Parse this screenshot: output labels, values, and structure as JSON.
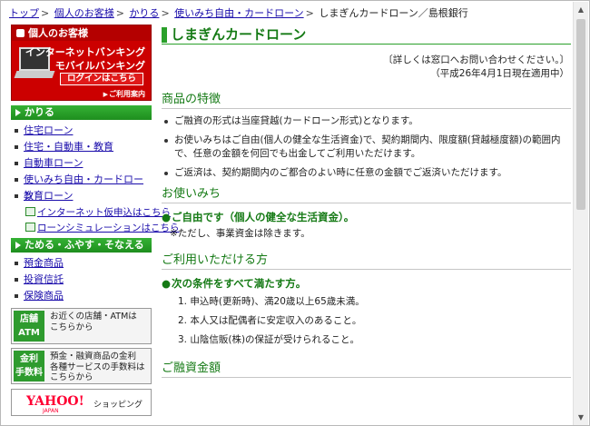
{
  "breadcrumb": {
    "items": [
      "トップ",
      "個人のお客様",
      "かりる",
      "使いみち自由・カードローン"
    ],
    "current": "しまぎんカードローン／島根銀行",
    "separator": ">"
  },
  "banner": {
    "header": "個人のお客様",
    "line1": "インターネットバンキング",
    "line2": "モバイルバンキング",
    "login": "ログインはこちら",
    "guide": "ご利用案内"
  },
  "sidebar": {
    "section1": "かりる",
    "items1": [
      "住宅ローン",
      "住宅・自動車・教育",
      "自動車ローン",
      "使いみち自由・カードローン",
      "教育ローン"
    ],
    "sub_links": [
      "インターネット仮申込はこちら",
      "ローンシミュレーションはこちら"
    ],
    "section2": "ためる・ふやす・そなえる",
    "items2": [
      "預金商品",
      "投資信託",
      "保険商品"
    ],
    "atm_box": {
      "label1": "店舗",
      "label2": "ATM",
      "text1": "お近くの店舗・ATMは",
      "text2": "こちらから"
    },
    "fee_box": {
      "label1": "金利",
      "label2": "手数料",
      "text1": "預金・融資商品の金利",
      "text2": "各種サービスの手数料は",
      "text3": "こちらから"
    },
    "yahoo": {
      "logo": "YAHOO!",
      "sub": "JAPAN",
      "text": "ショッピング"
    }
  },
  "main": {
    "title": "しまぎんカードローン",
    "note1": "〔詳しくは窓口へお問い合わせください。〕",
    "note2": "（平成26年4月1日現在適用中）",
    "sec1_title": "商品の特徴",
    "sec1_items": [
      "ご融資の形式は当座貸越(カードローン形式)となります。",
      "お使いみちはご自由(個人の健全な生活資金)で、契約期間内、限度額(貸越極度額)の範囲内で、任意の金額を何回でも出金してご利用いただけます。",
      "ご返済は、契約期間内のご都合のよい時に任意の金額でご返済いただけます。"
    ],
    "sec2_title": "お使いみち",
    "sec2_lead": "ご自由です（個人の健全な生活資金）。",
    "sec2_note": "※ただし、事業資金は除きます。",
    "sec3_title": "ご利用いただける方",
    "sec3_lead": "次の条件をすべて満たす方。",
    "sec3_items": [
      "1. 申込時(更新時)、満20歳以上65歳未満。",
      "2. 本人又は配偶者に安定収入のあること。",
      "3. 山陰信販(株)の保証が受けられること。"
    ],
    "sec4_title": "ご融資金額"
  }
}
